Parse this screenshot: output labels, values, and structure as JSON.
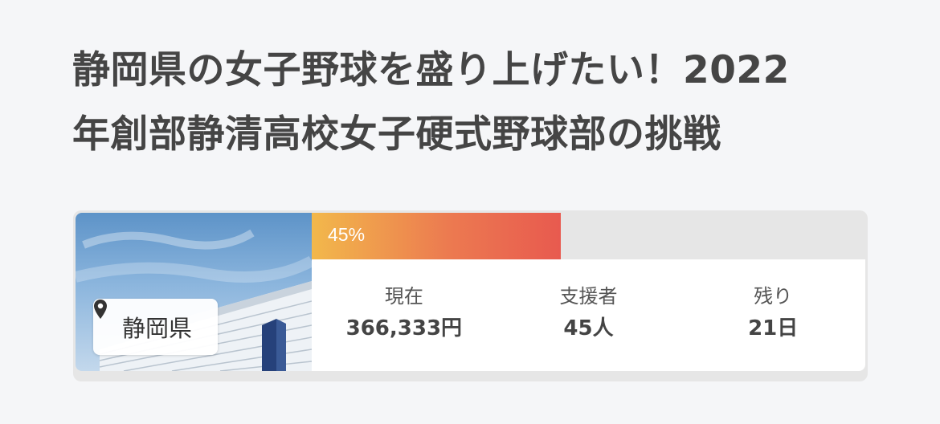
{
  "project": {
    "title_line1": "静岡県の女子野球を盛り上げたい！2022",
    "title_line2": "年創部静清高校女子硬式野球部の挑戦",
    "location": "静岡県",
    "location_icon": "map-pin-icon",
    "progress_percent": 45,
    "progress_label": "45%",
    "accent_gradient": [
      "#f2b84b",
      "#ec7a50",
      "#e85a4f"
    ]
  },
  "stats": [
    {
      "label": "現在",
      "value": "366,333円"
    },
    {
      "label": "支援者",
      "value": "45人"
    },
    {
      "label": "残り",
      "value": "21日"
    }
  ]
}
